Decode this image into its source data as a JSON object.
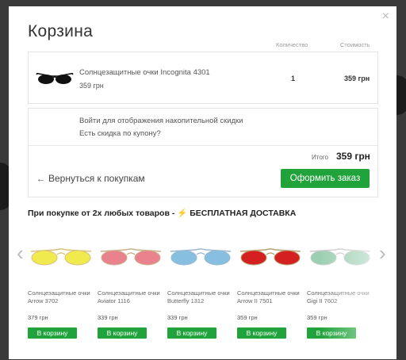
{
  "modal": {
    "title": "Корзина",
    "close_label": "×",
    "columns": {
      "quantity": "Количество",
      "cost": "Стоимость"
    }
  },
  "cart_item": {
    "name": "Солнцезащитные очки Incognita 4301",
    "price": "359 грн",
    "quantity": "1",
    "total": "359 грн"
  },
  "summary": {
    "login_prompt": "Войти для отображения накопительной скидки",
    "coupon_prompt": "Есть скидка по купону?",
    "total_label": "Итого",
    "total_value": "359 грн",
    "back_label": "Вернуться к покупкам",
    "order_button": "Оформить заказ"
  },
  "promo": {
    "text": "При покупке от 2х любых товаров -",
    "bolt": "⚡",
    "free_delivery": "БЕСПЛАТНАЯ ДОСТАВКА"
  },
  "carousel": {
    "prev": "‹",
    "next": "›",
    "products": [
      {
        "name": "Солнцезащитные очки Arrow 3702",
        "price": "379 грн",
        "button": "В корзину",
        "lens_color": "#f1ea4f",
        "frame_color": "#d8c27a"
      },
      {
        "name": "Солнцезащитные очки Aviator 1116",
        "price": "339 грн",
        "button": "В корзину",
        "lens_color": "#e9828c",
        "frame_color": "#c9b08a"
      },
      {
        "name": "Солнцезащитные очки Butterfly 1312",
        "price": "339 грн",
        "button": "В корзину",
        "lens_color": "#86bfe0",
        "frame_color": "#9ab8cf"
      },
      {
        "name": "Солнцезащитные очки Arrow II 7501",
        "price": "359 грн",
        "button": "В корзину",
        "lens_color": "#d42020",
        "frame_color": "#b8a070"
      },
      {
        "name": "Солнцезащитные очки Gigi II 7602",
        "price": "359 грн",
        "button": "В корзину",
        "lens_color": "#9ccfb2",
        "frame_color": "#c8c8c8"
      }
    ]
  },
  "colors": {
    "accent_green": "#1fa33a",
    "bolt_yellow": "#f2b705"
  }
}
